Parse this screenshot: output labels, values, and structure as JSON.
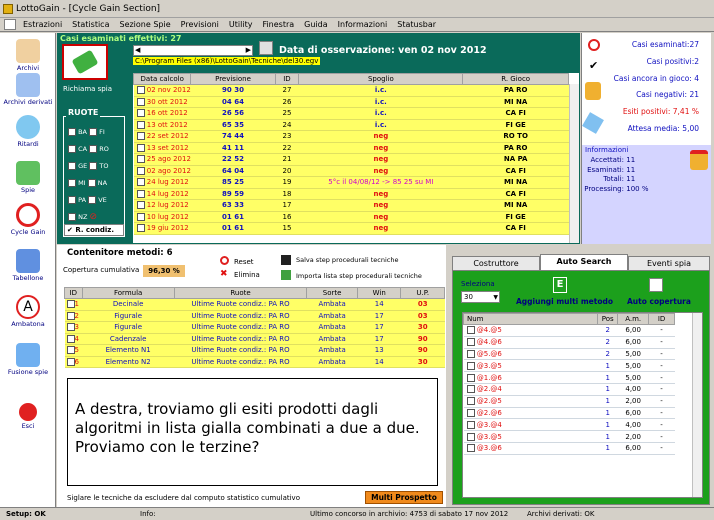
{
  "window": {
    "title": "LottoGain - [Cycle Gain Section]"
  },
  "menu": [
    "Estrazioni",
    "Statistica",
    "Sezione Spie",
    "Previsioni",
    "Utility",
    "Finestra",
    "Guida",
    "Informazioni",
    "Statusbar"
  ],
  "sidebar": [
    {
      "label": "Archivi",
      "icon": "pencil-icon",
      "color": "#c08040"
    },
    {
      "label": "Archivi derivati",
      "icon": "archive-icon",
      "color": "#3070c0"
    },
    {
      "label": "Ritardi",
      "icon": "clock-icon",
      "color": "#3070c0"
    },
    {
      "label": "Spie",
      "icon": "pill-icon",
      "color": "#40a040"
    },
    {
      "label": "Cycle Gain",
      "icon": "cycle-icon",
      "color": "#e02020"
    },
    {
      "label": "Tabellone",
      "icon": "calendar-icon",
      "color": "#3070c0"
    },
    {
      "label": "Ambatona",
      "icon": "letter-a-icon",
      "color": "#e02020"
    },
    {
      "label": "Fusione spie",
      "icon": "merge-icon",
      "color": "#3070c0"
    },
    {
      "label": "Esci",
      "icon": "exit-icon",
      "color": "#e02020"
    }
  ],
  "top": {
    "casi_label": "Casi esaminati effettivi: 27",
    "path": "C:\\Program Files (x86)\\LottoGain\\Tecniche\\del30.egv",
    "obs_label": "Data di osservazione:",
    "obs_date": "ven 02 nov 2012",
    "richiama": "Richiama spia",
    "ruote_title": "RUOTE",
    "ruote": [
      "BA",
      "FI",
      "CA",
      "RO",
      "GE",
      "TO",
      "MI",
      "NA",
      "PA",
      "VE",
      "NZ"
    ],
    "rcondiz": "R. condiz."
  },
  "table1": {
    "headers": [
      "Data calcolo",
      "Previsione",
      "ID",
      "Spoglio",
      "R. Gioco"
    ],
    "rows": [
      [
        "02 nov 2012",
        "90 30",
        "27",
        "i.c.",
        "PA RO"
      ],
      [
        "30 ott 2012",
        "04 64",
        "26",
        "i.c.",
        "MI NA"
      ],
      [
        "16 ott 2012",
        "26 56",
        "25",
        "i.c.",
        "CA FI"
      ],
      [
        "13 ott 2012",
        "65 35",
        "24",
        "i.c.",
        "FI GE"
      ],
      [
        "22 set 2012",
        "74 44",
        "23",
        "neg",
        "RO TO"
      ],
      [
        "13 set 2012",
        "41 11",
        "22",
        "neg",
        "PA RO"
      ],
      [
        "25 ago 2012",
        "22 52",
        "21",
        "neg",
        "NA PA"
      ],
      [
        "02 ago 2012",
        "64 04",
        "20",
        "neg",
        "CA FI"
      ],
      [
        "24 lug 2012",
        "85 25",
        "19",
        "5°c il 04/08/12 -> 85 25 su MI",
        "MI NA"
      ],
      [
        "14 lug 2012",
        "89 59",
        "18",
        "neg",
        "CA FI"
      ],
      [
        "12 lug 2012",
        "63 33",
        "17",
        "neg",
        "MI NA"
      ],
      [
        "10 lug 2012",
        "01 61",
        "16",
        "neg",
        "FI GE"
      ],
      [
        "19 giu 2012",
        "01 61",
        "15",
        "neg",
        "CA FI"
      ]
    ]
  },
  "stats": {
    "esaminati": "Casi esaminati:27",
    "positivi": "Casi positivi:2",
    "in_gioco": "Casi ancora in gioco: 4",
    "negativi": "Casi negativi: 21",
    "esiti": "Esiti positivi: 7,41 %",
    "attesa": "Attesa media: 5,00"
  },
  "info": {
    "title": "Informazioni",
    "accettati": "Accettati:",
    "accettati_v": "11",
    "esaminati": "Esaminati:",
    "esaminati_v": "11",
    "totali": "Totali:",
    "totali_v": "11",
    "processing": "Processing:",
    "processing_v": "100 %"
  },
  "contenitore": {
    "title": "Contenitore metodi: 6",
    "copertura_label": "Copertura cumulativa",
    "copertura_value": "96,30 %",
    "reset": "Reset",
    "elimina": "Elimina",
    "salva": "Salva step procedurali tecniche",
    "importa": "Importa lista step procedurali tecniche",
    "headers": [
      "ID",
      "Formula",
      "Ruote",
      "Sorte",
      "Win",
      "U.P."
    ],
    "rows": [
      [
        "1",
        "Decinale",
        "Ultime Ruote condiz.: PA RO",
        "Ambata",
        "14",
        "03"
      ],
      [
        "2",
        "Figurale",
        "Ultime Ruote condiz.: PA RO",
        "Ambata",
        "17",
        "03"
      ],
      [
        "3",
        "Figurale",
        "Ultime Ruote condiz.: PA RO",
        "Ambata",
        "17",
        "30"
      ],
      [
        "4",
        "Cadenzale",
        "Ultime Ruote condiz.: PA RO",
        "Ambata",
        "17",
        "90"
      ],
      [
        "5",
        "Elemento N1",
        "Ultime Ruote condiz.: PA RO",
        "Ambata",
        "13",
        "90"
      ],
      [
        "6",
        "Elemento N2",
        "Ultime Ruote condiz.: PA RO",
        "Ambata",
        "14",
        "30"
      ]
    ],
    "footer": "Siglare le tecniche da escludere dal computo statistico cumulativo",
    "multi": "Multi Prospetto"
  },
  "right": {
    "tabs": [
      "Costruttore",
      "Auto Search",
      "Eventi spia"
    ],
    "seleziona": "Seleziona",
    "select_value": "30",
    "aggiungi": "Aggiungi multi metodo",
    "auto": "Auto copertura",
    "headers": [
      "Num",
      "Pos",
      "A.m.",
      "ID"
    ],
    "rows": [
      [
        "@4.@5",
        "2",
        "6,00",
        "-"
      ],
      [
        "@4.@6",
        "2",
        "6,00",
        "-"
      ],
      [
        "@5.@6",
        "2",
        "5,00",
        "-"
      ],
      [
        "@3.@5",
        "1",
        "5,00",
        "-"
      ],
      [
        "@1.@6",
        "1",
        "5,00",
        "-"
      ],
      [
        "@2.@4",
        "1",
        "4,00",
        "-"
      ],
      [
        "@2.@5",
        "1",
        "2,00",
        "-"
      ],
      [
        "@2.@6",
        "1",
        "6,00",
        "-"
      ],
      [
        "@3.@4",
        "1",
        "4,00",
        "-"
      ],
      [
        "@3.@5",
        "1",
        "2,00",
        "-"
      ],
      [
        "@3.@6",
        "1",
        "6,00",
        "-"
      ]
    ]
  },
  "status": {
    "setup": "Setup: OK",
    "info": "Info:",
    "ultimo": "Ultimo concorso in archivio: 4753 di sabato 17 nov 2012",
    "derivati": "Archivi derivati: OK"
  },
  "callout": "A destra, troviamo gli esiti prodotti dagli algoritmi in lista gialla combinati a due a due. Proviamo con le terzine?"
}
